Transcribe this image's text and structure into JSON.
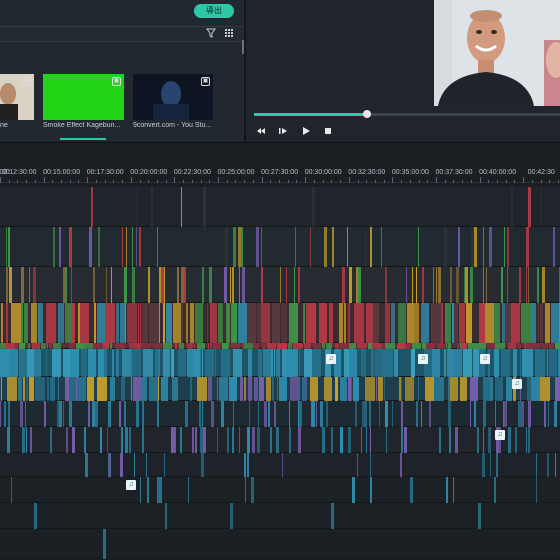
{
  "header": {
    "export_label": "導出"
  },
  "media": {
    "toolbar_icons": [
      "filter-icon",
      "grid-icon"
    ],
    "thumbnails": [
      {
        "label": "ne",
        "bg": "#e9e2d6"
      },
      {
        "label": "Smoke Effect  Kagebun...",
        "bg": "#21d418"
      },
      {
        "label": "9convert.com - You Stu...",
        "bg": "#0d1522"
      }
    ]
  },
  "preview": {
    "progress": 0.37,
    "controls": [
      "prev-frame-icon",
      "step-icon",
      "play-icon",
      "stop-icon"
    ]
  },
  "timeline": {
    "ruler": [
      "00:12:30:00",
      "00:15:00:00",
      "00:17:30:00",
      "00:20:00:00",
      "00:22:30:00",
      "00:25:00:00",
      "00:27:30:00",
      "00:30:00:00",
      "00:32:30:00",
      "00:35:00:00",
      "00:37:30:00",
      "00:40:00:00",
      "00:42:30"
    ],
    "ruler_left_label": "00",
    "colors": {
      "bg": "#1b1f23",
      "accent": "#2fc8a6",
      "marker": "#d04b5c",
      "video": "#2f8fb0",
      "audio": "#27748f",
      "yellow": "#c9a02a",
      "purple": "#7a5fb0",
      "red": "#b43a46",
      "green": "#3f9b4a",
      "gray": "#2d353d"
    }
  }
}
